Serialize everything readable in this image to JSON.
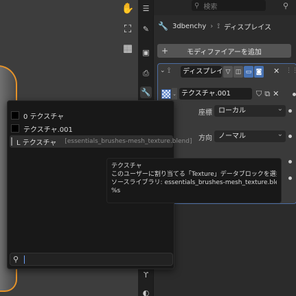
{
  "colors": {
    "accent": "#4772b3",
    "selection_outline": "#e6932a",
    "panel": "#3a3a3a",
    "popup": "#181818"
  },
  "viewport": {
    "nav_icons": [
      "hand-icon",
      "camera-icon",
      "grid-icon"
    ]
  },
  "properties": {
    "search_placeholder": "検索",
    "breadcrumb": {
      "object": "3dbenchy",
      "modifier": "ディスプレイス"
    },
    "add_modifier_label": "モディファイアーを追加",
    "modifier": {
      "name": "ディスプレイス",
      "texture": "テクスチャ.001",
      "coordinates_label": "座標",
      "coordinates_value": "ローカル",
      "direction_label": "方向",
      "direction_value": "ノーマル"
    }
  },
  "popup": {
    "items": [
      {
        "label": "0 テクスチャ",
        "extra": ""
      },
      {
        "label": "テクスチャ.001",
        "extra": ""
      },
      {
        "label": "L テクスチャ",
        "extra": "[essentials_brushes-mesh_texture.blend]"
      }
    ]
  },
  "tooltip": {
    "title": "テクスチャ",
    "description": "このユーザーに割り当てる「Texture」データブロックを選択します",
    "source": "ソースライブラリ: essentials_brushes-mesh_texture.blend",
    "python": "%s"
  }
}
